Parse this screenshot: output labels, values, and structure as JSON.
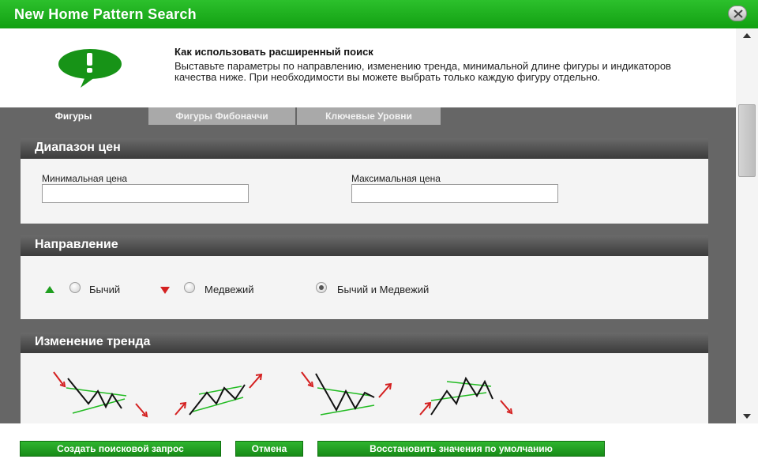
{
  "window": {
    "title": "New Home Pattern Search"
  },
  "info": {
    "heading": "Как использовать расширенный поиск",
    "text": "Выставьте параметры по направлению, изменению тренда, минимальной длине фигуры и индикаторов качества ниже. При необходимости вы можете выбрать только каждую фигуру отдельно."
  },
  "tabs": [
    {
      "label": "Фигуры",
      "active": true
    },
    {
      "label": "Фигуры Фибоначчи",
      "active": false
    },
    {
      "label": "Ключевые Уровни",
      "active": false
    }
  ],
  "price_range": {
    "title": "Диапазон цен",
    "min_label": "Минимальная цена",
    "min_value": "",
    "max_label": "Максимальная цена",
    "max_value": ""
  },
  "direction": {
    "title": "Направление",
    "options": [
      {
        "label": "Бычий",
        "icon": "arrow-up-icon",
        "checked": false
      },
      {
        "label": "Медвежий",
        "icon": "arrow-down-icon",
        "checked": false
      },
      {
        "label": "Бычий и Медвежий",
        "checked": true
      }
    ]
  },
  "trend_change": {
    "title": "Изменение тренда"
  },
  "footer": {
    "create_label": "Создать поисковой запрос",
    "cancel_label": "Отмена",
    "restore_label": "Восстановить значения по умолчанию"
  },
  "colors": {
    "accent": "#17a017",
    "section_header": "#4a4a4a",
    "bullish": "#1f9e1f",
    "bearish": "#d42020"
  }
}
